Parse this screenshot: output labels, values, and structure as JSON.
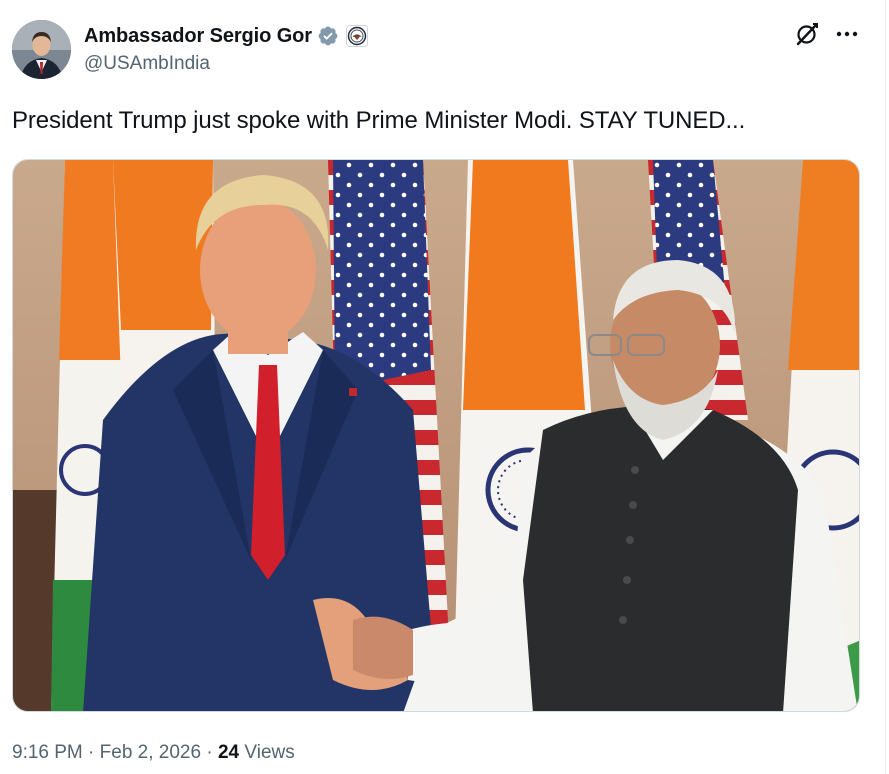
{
  "author": {
    "display_name": "Ambassador Sergio Gor",
    "handle": "@USAmbIndia",
    "verified_icon": "verified-badge-icon",
    "affiliation_icon": "us-state-department-seal-icon",
    "verified_color": "#829aab"
  },
  "actions": {
    "grok_icon": "grok-icon",
    "more_icon": "more-options-icon"
  },
  "tweet": {
    "text": "President Trump just spoke with Prime Minister Modi. STAY TUNED..."
  },
  "media": {
    "type": "photo"
  },
  "meta": {
    "time": "9:16 PM",
    "separator": "·",
    "date": "Feb 2, 2026",
    "views_count": "24",
    "views_label": "Views"
  },
  "colors": {
    "text_primary": "#0f1419",
    "text_secondary": "#536471",
    "border": "#cfd9de"
  }
}
